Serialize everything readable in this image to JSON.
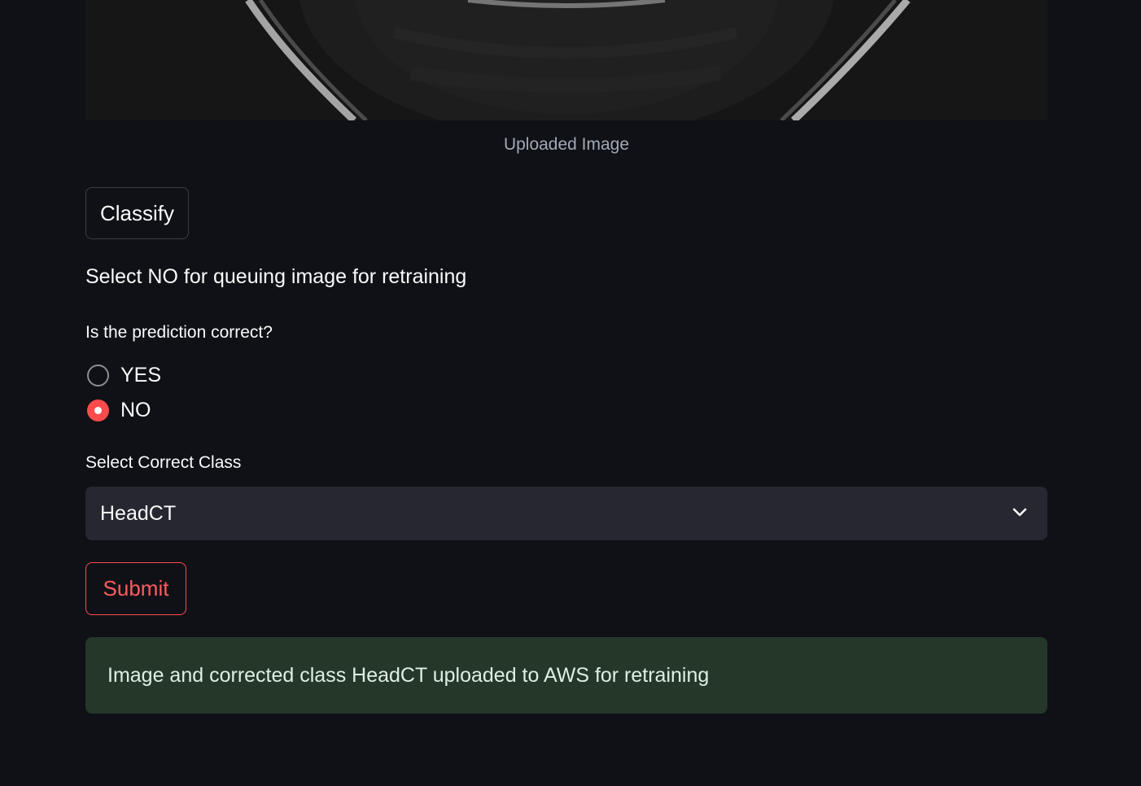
{
  "image": {
    "caption": "Uploaded Image"
  },
  "actions": {
    "classify_label": "Classify",
    "submit_label": "Submit"
  },
  "instruction": "Select NO for queuing image for retraining",
  "feedback": {
    "question": "Is the prediction correct?",
    "options": [
      "YES",
      "NO"
    ],
    "selected": "NO"
  },
  "correction": {
    "label": "Select Correct Class",
    "selected_value": "HeadCT",
    "dropdown_icon": "chevron-down-icon"
  },
  "status": {
    "message": "Image and corrected class HeadCT uploaded to AWS for retraining"
  },
  "colors": {
    "background": "#0f1117",
    "accent": "#ff4b4b",
    "select_bg": "#262730",
    "success_bg": "#253729"
  }
}
